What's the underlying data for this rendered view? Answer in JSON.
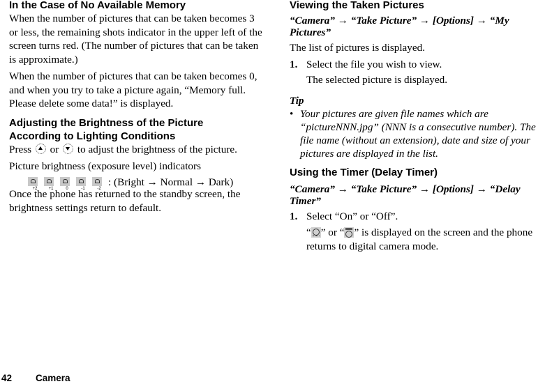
{
  "left": {
    "memory": {
      "heading": "In the Case of No Available Memory",
      "para1": "When the number of pictures that can be taken becomes 3 or less, the remaining shots indicator in the upper left of the screen turns red. (The number of pictures that can be taken is approximate.)",
      "para2": "When the number of pictures that can be taken becomes 0, and when you try to take a picture again, “Memory full. Please delete some data!” is displayed."
    },
    "brightness": {
      "heading_line1": "Adjusting the Brightness of the Picture",
      "heading_line2": "According to Lighting Conditions",
      "press_prefix": "Press",
      "key_up_icon": "navigation-up-key-icon",
      "press_or": "or",
      "key_down_icon": "navigation-down-key-icon",
      "press_suffix": "to adjust the brightness of the picture.",
      "indicators_label": "Picture brightness (exposure level) indicators",
      "exposure_levels": [
        "+2",
        "+1",
        "0",
        "-1",
        "-2"
      ],
      "exposure_icon": "exposure-level-icon",
      "indicator_caption": ": (Bright → Normal → Dark)",
      "note": "Once the phone has returned to the standby screen, the brightness settings return to default."
    }
  },
  "right": {
    "viewing": {
      "heading": "Viewing the Taken Pictures",
      "path": [
        "“Camera”",
        "“Take Picture”",
        "[Options]",
        "“My Pictures”"
      ],
      "arrow": "→",
      "intro": "The list of pictures is displayed.",
      "steps": [
        {
          "num": "1.",
          "text": "Select the file you wish to view.",
          "result": "The selected picture is displayed."
        }
      ]
    },
    "tip": {
      "title": "Tip",
      "bullet": "•",
      "items": [
        "Your pictures are given file names which are “pictureNNN.jpg” (NNN is a consecutive number). The file name (without an extension), date and size of your pictures are displayed in the list."
      ]
    },
    "timer": {
      "heading": "Using the Timer (Delay Timer)",
      "path": [
        "“Camera”",
        "“Take Picture”",
        "[Options]",
        "“Delay Timer”"
      ],
      "arrow": "→",
      "steps": [
        {
          "num": "1.",
          "text": "Select “On” or “Off”.",
          "result_q1": "“",
          "icon1": "delay-timer-on-icon",
          "result_mid": "” or “",
          "icon2": "delay-timer-active-icon",
          "result_end": "” is displayed on the screen and the phone returns to digital camera mode."
        }
      ]
    }
  },
  "footer": {
    "page_number": "42",
    "section": "Camera"
  }
}
